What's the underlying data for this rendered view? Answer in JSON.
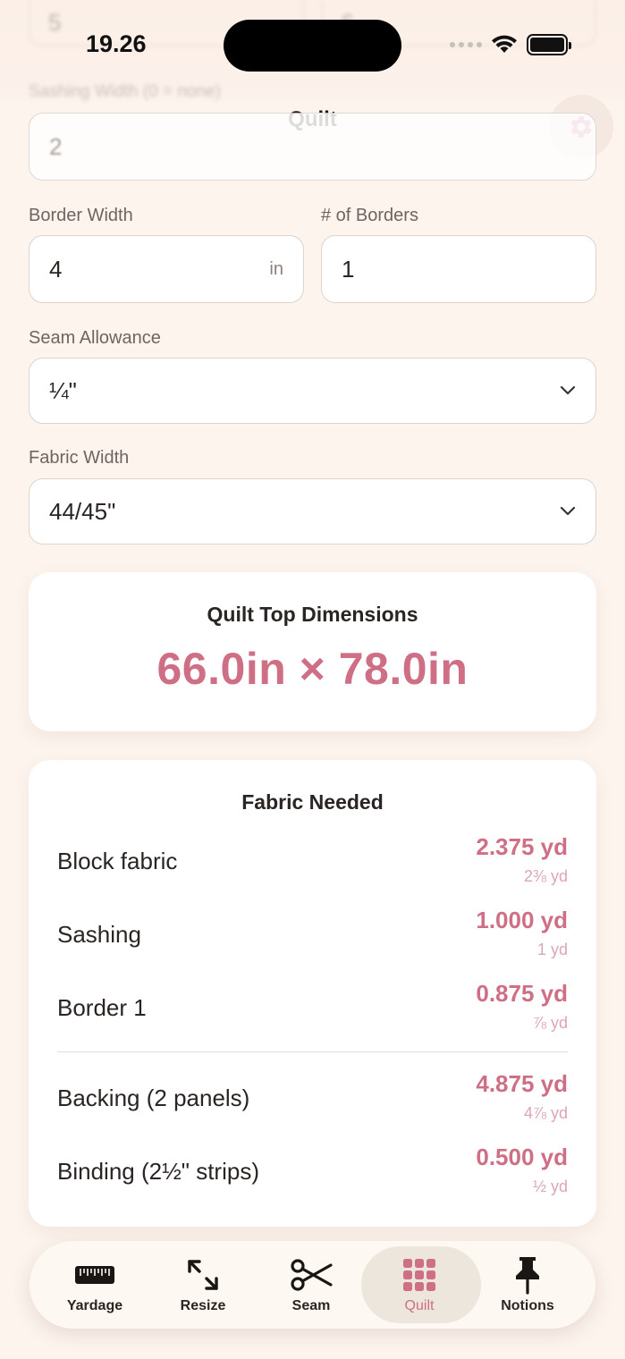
{
  "status_bar": {
    "time": "19.26"
  },
  "top_blur": {
    "left_value": "5",
    "right_value": "6",
    "label": "Sashing Width (0 = none)"
  },
  "nav": {
    "title": "Quilt"
  },
  "form": {
    "sashing_width": {
      "value": "2"
    },
    "border_width": {
      "label": "Border Width",
      "value": "4",
      "unit": "in"
    },
    "num_borders": {
      "label": "# of Borders",
      "value": "1"
    },
    "seam_allowance": {
      "label": "Seam Allowance",
      "value": "¼\""
    },
    "fabric_width": {
      "label": "Fabric Width",
      "value": "44/45\""
    }
  },
  "dimensions": {
    "title": "Quilt Top Dimensions",
    "value": "66.0in × 78.0in"
  },
  "fabric": {
    "title": "Fabric Needed",
    "items": [
      {
        "name": "Block fabric",
        "yards": "2.375 yd",
        "fraction": "2⅜ yd"
      },
      {
        "name": "Sashing",
        "yards": "1.000 yd",
        "fraction": "1 yd"
      },
      {
        "name": "Border 1",
        "yards": "0.875 yd",
        "fraction": "⅞ yd"
      },
      {
        "name": "Backing (2 panels)",
        "yards": "4.875 yd",
        "fraction": "4⅞ yd"
      },
      {
        "name": "Binding (2½\" strips)",
        "yards": "0.500 yd",
        "fraction": "½ yd"
      }
    ]
  },
  "tabs": [
    {
      "label": "Yardage",
      "icon": "ruler-icon"
    },
    {
      "label": "Resize",
      "icon": "resize-arrows-icon"
    },
    {
      "label": "Seam",
      "icon": "scissors-icon"
    },
    {
      "label": "Quilt",
      "icon": "grid-icon",
      "active": true
    },
    {
      "label": "Notions",
      "icon": "pushpin-icon"
    }
  ],
  "colors": {
    "accent": "#cf6f86",
    "background": "#fdf4ee",
    "card": "#ffffff",
    "active_tab_bg": "#ece6dc"
  }
}
